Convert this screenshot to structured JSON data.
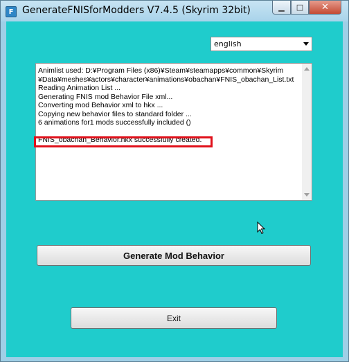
{
  "window": {
    "title": "GenerateFNISforModders V7.4.5 (Skyrim 32bit)",
    "app_icon_glyph": "F",
    "minimize_glyph": "▁",
    "maximize_glyph": "□",
    "close_glyph": "✕"
  },
  "language": {
    "selected": "english"
  },
  "log": {
    "lines": [
      "Animlist used: D:¥Program Files (x86)¥Steam¥steamapps¥common¥Skyrim",
      "¥Data¥meshes¥actors¥character¥animations¥obachan¥FNIS_obachan_List.txt",
      "Reading Animation List ...",
      "Generating FNIS mod Behavior File xml...",
      "Converting mod Behavior xml to hkx ...",
      "Copying new behavior files to standard folder ...",
      " 6 animations for1 mods successfully included ()",
      "",
      "FNIS_obachan_Behavior.hkx successfully created."
    ]
  },
  "buttons": {
    "generate": "Generate Mod Behavior",
    "exit": "Exit"
  },
  "colors": {
    "client_background": "#1fcccc",
    "highlight_border": "#e0101a"
  }
}
